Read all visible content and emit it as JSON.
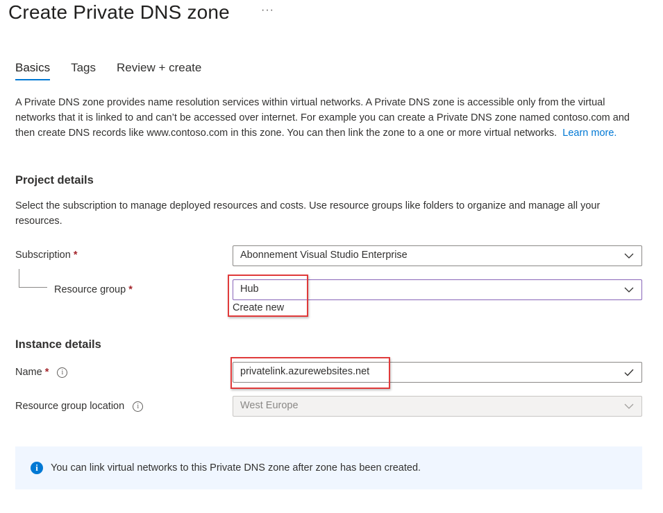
{
  "page": {
    "title": "Create Private DNS zone",
    "more_label": "···"
  },
  "tabs": [
    {
      "label": "Basics",
      "active": true
    },
    {
      "label": "Tags",
      "active": false
    },
    {
      "label": "Review + create",
      "active": false
    }
  ],
  "description": {
    "text": "A Private DNS zone provides name resolution services within virtual networks. A Private DNS zone is accessible only from the virtual networks that it is linked to and can’t be accessed over internet. For example you can create a Private DNS zone named contoso.com and then create DNS records like www.contoso.com in this zone. You can then link the zone to a one or more virtual networks.",
    "link": "Learn more."
  },
  "project": {
    "heading": "Project details",
    "subtext": "Select the subscription to manage deployed resources and costs. Use resource groups like folders to organize and manage all your resources.",
    "subscription_label": "Subscription",
    "subscription_value": "Abonnement Visual Studio Enterprise",
    "resource_group_label": "Resource group",
    "resource_group_value": "Hub",
    "create_new": "Create new",
    "required_mark": "*"
  },
  "instance": {
    "heading": "Instance details",
    "name_label": "Name",
    "name_value": "privatelink.azurewebsites.net",
    "location_label": "Resource group location",
    "location_value": "West Europe",
    "info_glyph": "i"
  },
  "banner": {
    "icon": "i",
    "text": "You can link virtual networks to this Private DNS zone after zone has been created."
  },
  "colors": {
    "accent": "#0078d4",
    "required": "#a4262c",
    "highlight": "#e03a3a",
    "focus_border": "#8764b8"
  }
}
